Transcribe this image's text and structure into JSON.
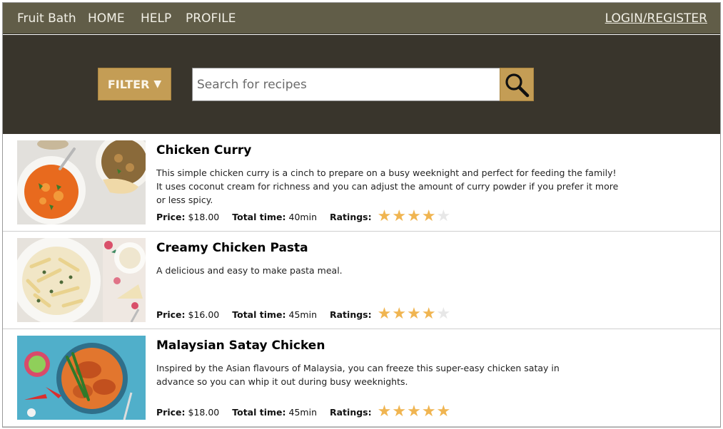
{
  "nav": {
    "brand": "Fruit Bath",
    "home": "HOME",
    "help": "HELP",
    "profile": "PROFILE",
    "login": "LOGIN/REGISTER"
  },
  "search": {
    "filter_label": "FILTER",
    "filter_icon": "caret-down-icon",
    "placeholder": "Search for recipes",
    "value": "",
    "search_icon": "magnifier-icon"
  },
  "labels": {
    "price": "Price:",
    "total_time": "Total time:",
    "ratings": "Ratings:"
  },
  "recipes": [
    {
      "title": "Chicken Curry",
      "description": "This simple chicken curry is a cinch to prepare on a busy weeknight and perfect for feeding the family! It uses coconut cream for richness and you can adjust the amount of curry powder if you prefer it more or less spicy.",
      "price": "$18.00",
      "total_time": "40min",
      "rating": 4,
      "rating_max": 5
    },
    {
      "title": "Creamy Chicken Pasta",
      "description": "A delicious and easy to make pasta meal.",
      "price": "$16.00",
      "total_time": "45min",
      "rating": 4,
      "rating_max": 5
    },
    {
      "title": "Malaysian Satay Chicken",
      "description": "Inspired by the Asian flavours of Malaysia, you can freeze this super-easy chicken satay in advance so you can whip it out during busy weeknights.",
      "price": "$18.00",
      "total_time": "45min",
      "rating": 5,
      "rating_max": 5
    }
  ],
  "colors": {
    "navbar": "#615d48",
    "search_band": "#39352c",
    "accent": "#c49d55",
    "star_on": "#f0b551",
    "star_off": "#e7e7e7"
  }
}
